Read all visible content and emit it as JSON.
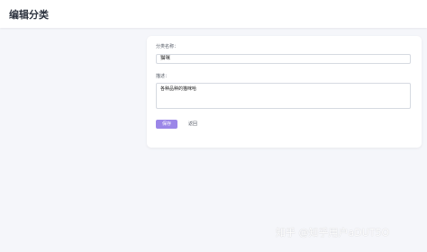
{
  "header": {
    "title": "编辑分类"
  },
  "form": {
    "name_label": "分类名称：",
    "name_value": "猫咪",
    "description_label": "描述：",
    "description_value": "各种品种的猫咪哈",
    "save_label": "保存",
    "back_label": "返回"
  },
  "watermark": {
    "text": "知乎 @知乎用户aDUT5O"
  },
  "colors": {
    "accent": "#9b86e8",
    "background": "#f5f6fa"
  }
}
